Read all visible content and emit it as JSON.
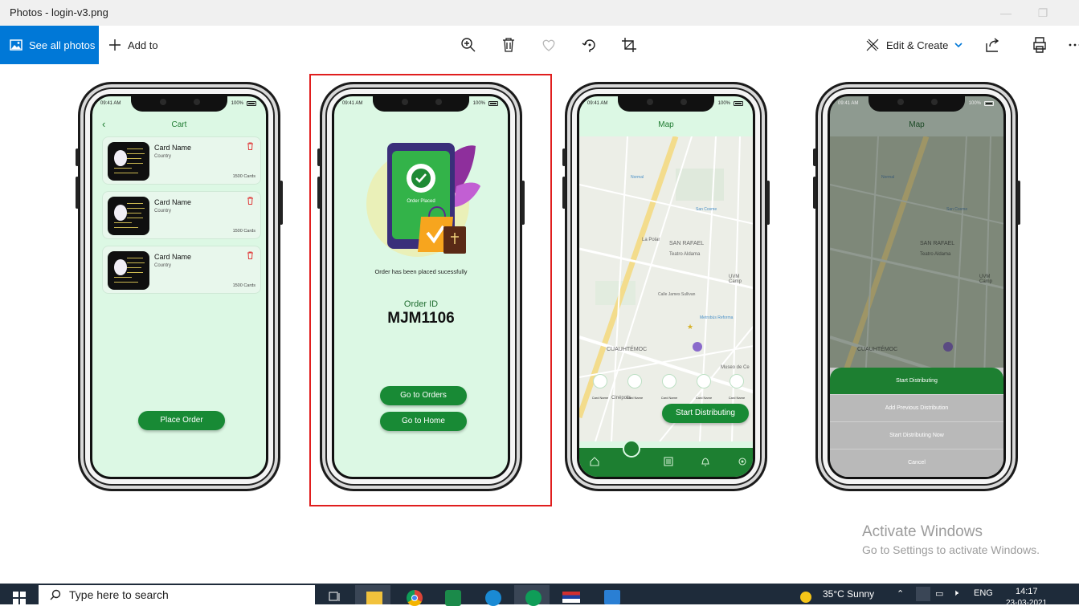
{
  "window": {
    "title": "Photos - login-v3.png"
  },
  "toolbar": {
    "see_all": "See all photos",
    "add_to": "Add to",
    "edit_create": "Edit & Create",
    "icons": [
      "zoom-in-icon",
      "delete-icon",
      "heart-icon",
      "rotate-icon",
      "crop-icon",
      "share-icon",
      "print-icon",
      "more-icon"
    ]
  },
  "screens": {
    "cart": {
      "time": "09:41 AM",
      "battery": "100%",
      "title": "Cart",
      "cards": [
        {
          "name": "Card Name",
          "country": "Country",
          "count": "1500 Cards"
        },
        {
          "name": "Card Name",
          "country": "Country",
          "count": "1500 Cards"
        },
        {
          "name": "Card Name",
          "country": "Country",
          "count": "1500 Cards"
        }
      ],
      "place_order": "Place Order"
    },
    "order": {
      "time": "09:41 AM",
      "battery": "100%",
      "badge": "Order Placed",
      "message": "Order has been placed sucessfully",
      "id_label": "Order ID",
      "id_value": "MJM1106",
      "go_orders": "Go to Orders",
      "go_home": "Go to Home"
    },
    "map": {
      "time": "09:41 AM",
      "battery": "100%",
      "title": "Map",
      "labels": [
        "SAN RAFAEL",
        "Teatro Aldama",
        "La Polar",
        "CUAUHTÉMOC",
        "UVM Camp",
        "Calle James Sullivan",
        "Normal",
        "San Cosme",
        "Museo de Ce",
        "Cinépolis",
        "Metrobús Reforma"
      ],
      "pin_labels": [
        "Card Name",
        "Card Name",
        "Card Name",
        "Card Name",
        "Card Name"
      ],
      "start_button": "Start Distributing"
    },
    "map_sheet": {
      "time": "09:41 AM",
      "battery": "100%",
      "title": "Map",
      "labels": [
        "SAN RAFAEL",
        "Teatro Aldama",
        "CUAUHTÉMOC",
        "UVM Camp",
        "Normal",
        "San Cosme"
      ],
      "options": [
        "Start Distributing",
        "Add Previous Distribution",
        "Start Distributing Now",
        "Cancel"
      ]
    }
  },
  "watermark": {
    "line1": "Activate Windows",
    "line2": "Go to Settings to activate Windows."
  },
  "taskbar": {
    "search_placeholder": "Type here to search",
    "weather": "35°C  Sunny",
    "lang": "ENG",
    "time": "14:17",
    "date": "23-03-2021"
  },
  "colors": {
    "accent": "#0078d7",
    "green": "#188a35",
    "selection": "#e01e1e"
  }
}
